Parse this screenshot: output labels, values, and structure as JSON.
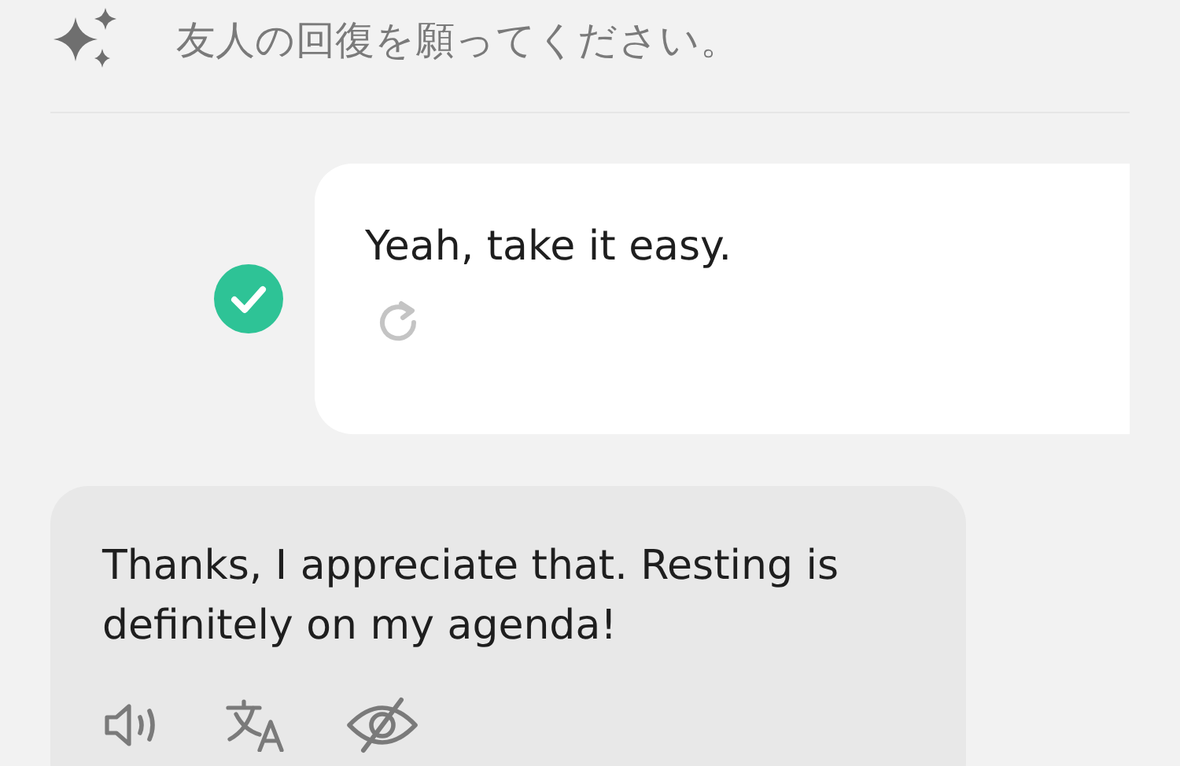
{
  "hint": {
    "text": "友人の回復を願ってください。"
  },
  "user_message": {
    "text": "Yeah, take it easy.",
    "checked": true
  },
  "reply_message": {
    "text": "Thanks, I appreciate that. Resting is definitely on my agenda!"
  }
}
